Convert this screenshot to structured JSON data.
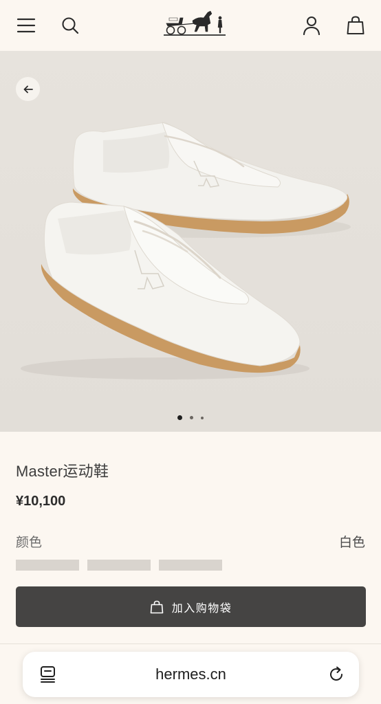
{
  "header": {
    "menu_icon": "hamburger-menu-icon",
    "search_icon": "search-icon",
    "logo_icon": "horse-carriage-logo",
    "account_icon": "user-icon",
    "bag_icon": "shopping-bag-icon"
  },
  "gallery": {
    "back_icon": "arrow-left-icon",
    "current_slide": 1,
    "total_slides": 3
  },
  "product": {
    "name": "Master运动鞋",
    "price": "¥10,100",
    "color_label": "颜色",
    "color_value": "白色",
    "swatch_count": 3
  },
  "actions": {
    "add_to_cart_label": "加入购物袋",
    "add_to_cart_icon": "shopping-bag-icon"
  },
  "browser": {
    "url": "hermes.cn",
    "tabs_icon": "tabs-list-icon",
    "reload_icon": "reload-icon"
  },
  "colors": {
    "background": "#fcf7f1",
    "button": "#454443",
    "hero_background": "#e5e1db"
  }
}
